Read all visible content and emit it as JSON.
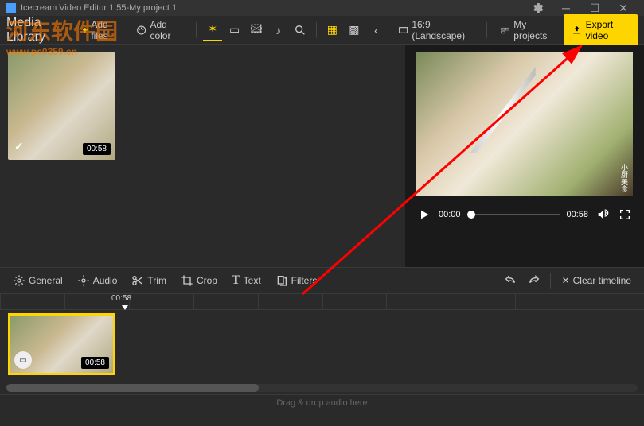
{
  "titlebar": {
    "app": "Icecream Video Editor 1.55",
    "sep": " - ",
    "project": "My project 1"
  },
  "watermark": {
    "main": "河东软件园",
    "sub": "www.pc0359.cn"
  },
  "topbar": {
    "media_library": "Media Library",
    "add_files": "Add files",
    "add_color": "Add color",
    "aspect": "16:9 (Landscape)",
    "my_projects": "My projects",
    "export": "Export video"
  },
  "library": {
    "clip_duration": "00:58"
  },
  "player": {
    "current": "00:00",
    "total": "00:58"
  },
  "editbar": {
    "general": "General",
    "audio": "Audio",
    "trim": "Trim",
    "crop": "Crop",
    "text": "Text",
    "filters": "Filters",
    "clear": "Clear timeline"
  },
  "timeline": {
    "playhead": "00:58",
    "clip_duration": "00:58",
    "audio_hint": "Drag & drop audio here"
  },
  "preview_corner": "小厨美食"
}
